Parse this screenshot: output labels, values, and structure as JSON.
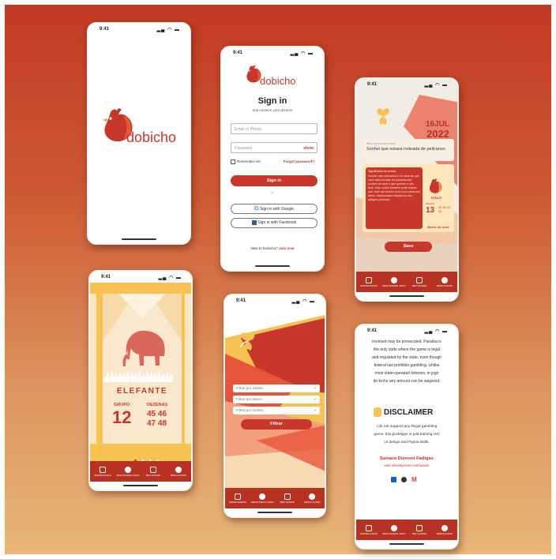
{
  "status": {
    "time": "9:41",
    "icons": "▂▄ ◠ ▬"
  },
  "brand": {
    "name": "dobicho"
  },
  "signin": {
    "title": "Sign in",
    "subtitle": "and connect your dreams",
    "email_placeholder": "Email or Phone",
    "password_placeholder": "Password",
    "show_label": "show",
    "remember_label": "Remember me",
    "forgot_label": "Forgot password?",
    "signin_button": "Sign in",
    "or_label": "or",
    "google_button": "Sign in with Google",
    "facebook_button": "Sign in with Facebook",
    "new_label": "New to Dobicho?",
    "join_label": "Join now"
  },
  "dream": {
    "day_month": "16JUL",
    "year": "2022",
    "dream_label": "Meu sonho de sonho",
    "dream_text": "Sonhei que estava rodeada de pelicanos",
    "meaning_label": "Significado do sonho",
    "meaning_text": "Sonhar com pelicanos é um sinal de que você está cercado de pessoas que cuidam de você e que querem o seu bem. Este sonho também pode indicar que você vai receber uma boa notícia em breve, relacionada à família ou aos amigos próximos.",
    "animal": "GALO",
    "group_label": "GRUPO",
    "group": "13",
    "numbers": [
      "49",
      "50",
      "51",
      "52"
    ],
    "ficha_label": "Bicho da sorte",
    "save_button": "Save"
  },
  "carousel": {
    "animal_name": "ELEFANTE",
    "group_label": "GRUPO",
    "group": "12",
    "dozens_label": "DEZENAS",
    "dozens": [
      "45 46",
      "47 48"
    ]
  },
  "filter": {
    "select1": "Filtrar por estado",
    "select2": "Filtrar por banca",
    "select3": "Filtrar por horário",
    "button": "Filtrar"
  },
  "disclaimer": {
    "intro_top": "involved may be prosecuted. Paraíba is",
    "intro_lines": [
      "the only state where the game is legal",
      "and regulated by the state, even though",
      "federal law prohibits gambling. Unlike",
      "most state-operated lotteries, in jogo",
      "do bicho any amount can be wagered."
    ],
    "title": "DISCLAIMER",
    "body_lines": [
      "I do not support any illegal gambling",
      "game, this prototype is just training UX/",
      "UI design and Figma skills."
    ],
    "author": "Samara Dumont Fadigas",
    "role": "web development enthusiast"
  },
  "tabs": {
    "labels": [
      "SIGNIFICADOS",
      "RESULTADOS JOGO",
      "MEU SONHO",
      "MINHA CONTA"
    ]
  },
  "colors": {
    "accent": "#c8372b",
    "yellow": "#f6c252",
    "cream": "#f5e6cc"
  }
}
